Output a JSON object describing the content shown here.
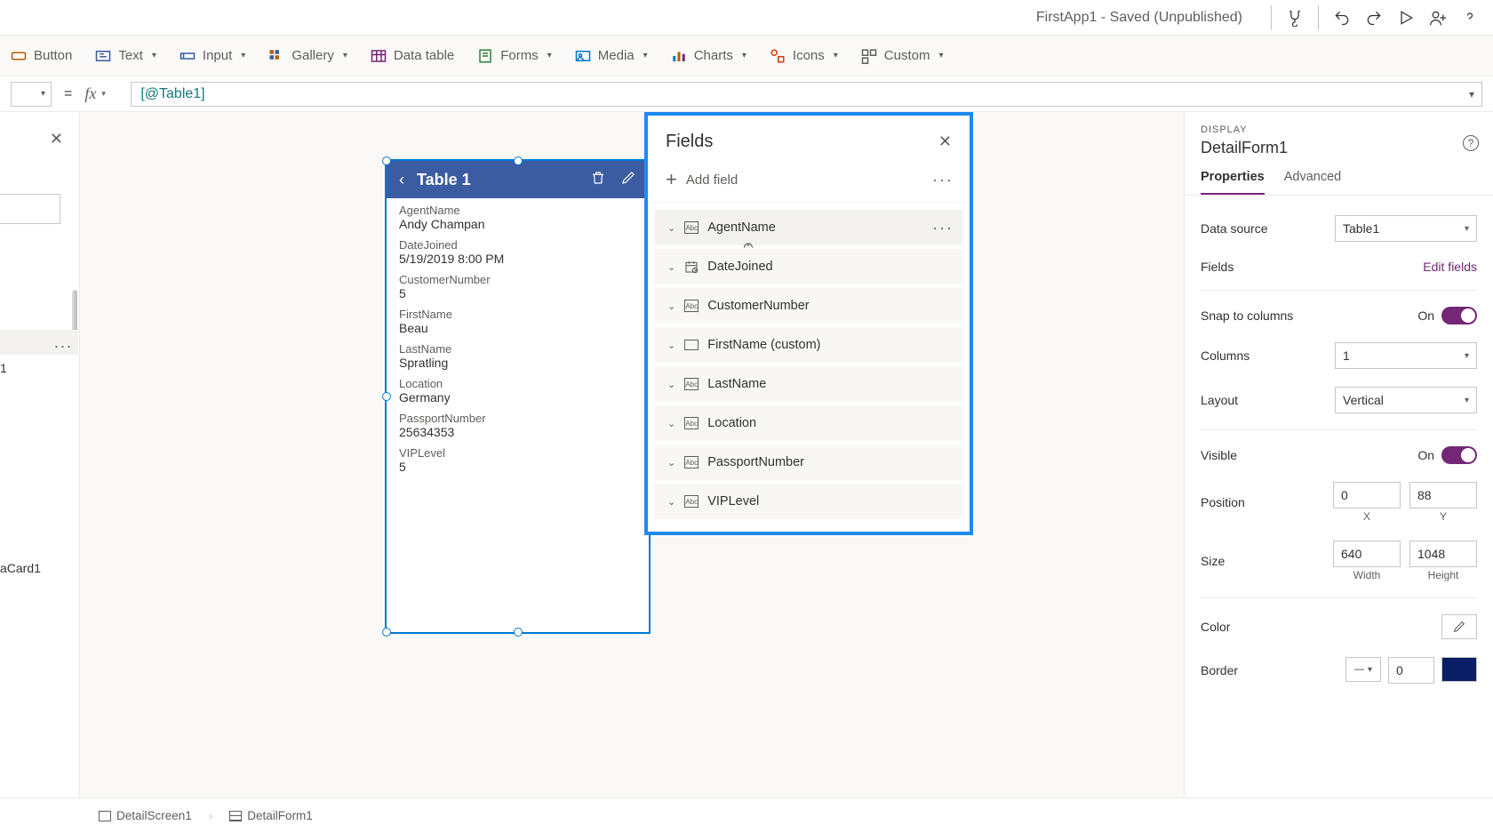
{
  "title_bar": {
    "title": "FirstApp1 - Saved (Unpublished)"
  },
  "ribbon": {
    "button": "Button",
    "text": "Text",
    "input": "Input",
    "gallery": "Gallery",
    "data_table": "Data table",
    "forms": "Forms",
    "media": "Media",
    "charts": "Charts",
    "icons": "Icons",
    "custom": "Custom"
  },
  "formula_bar": {
    "equals": "=",
    "fx": "fx",
    "formula": "[@Table1]"
  },
  "tree": {
    "selected_more": "...",
    "item_partial_1": "1",
    "item_partial_2": "aCard1"
  },
  "form": {
    "title": "Table 1",
    "cards": [
      {
        "label": "AgentName",
        "value": "Andy Champan"
      },
      {
        "label": "DateJoined",
        "value": "5/19/2019 8:00 PM"
      },
      {
        "label": "CustomerNumber",
        "value": "5"
      },
      {
        "label": "FirstName",
        "value": "Beau"
      },
      {
        "label": "LastName",
        "value": "Spratling"
      },
      {
        "label": "Location",
        "value": "Germany"
      },
      {
        "label": "PassportNumber",
        "value": "25634353"
      },
      {
        "label": "VIPLevel",
        "value": "5"
      }
    ]
  },
  "fields_popup": {
    "title": "Fields",
    "add_field": "Add field",
    "items": [
      {
        "name": "AgentName",
        "type": "abc",
        "hovered": true
      },
      {
        "name": "DateJoined",
        "type": "date"
      },
      {
        "name": "CustomerNumber",
        "type": "abc"
      },
      {
        "name": "FirstName (custom)",
        "type": "custom"
      },
      {
        "name": "LastName",
        "type": "abc"
      },
      {
        "name": "Location",
        "type": "abc"
      },
      {
        "name": "PassportNumber",
        "type": "abc"
      },
      {
        "name": "VIPLevel",
        "type": "abc"
      }
    ]
  },
  "props": {
    "category": "DISPLAY",
    "name": "DetailForm1",
    "tabs": {
      "properties": "Properties",
      "advanced": "Advanced"
    },
    "data_source_label": "Data source",
    "data_source_value": "Table1",
    "fields_label": "Fields",
    "edit_fields": "Edit fields",
    "snap_label": "Snap to columns",
    "snap_value": "On",
    "columns_label": "Columns",
    "columns_value": "1",
    "layout_label": "Layout",
    "layout_value": "Vertical",
    "visible_label": "Visible",
    "visible_value": "On",
    "position_label": "Position",
    "pos_x": "0",
    "pos_y": "88",
    "pos_x_lbl": "X",
    "pos_y_lbl": "Y",
    "size_label": "Size",
    "size_w": "640",
    "size_h": "1048",
    "size_w_lbl": "Width",
    "size_h_lbl": "Height",
    "color_label": "Color",
    "border_label": "Border",
    "border_width": "0"
  },
  "breadcrumb": {
    "screen": "DetailScreen1",
    "form": "DetailForm1"
  }
}
